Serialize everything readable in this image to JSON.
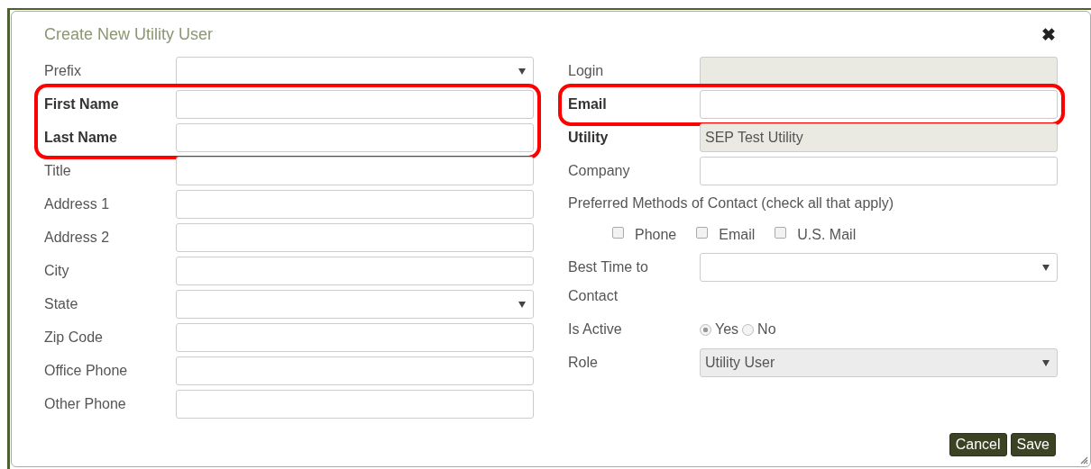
{
  "dialog": {
    "title": "Create New Utility User",
    "close": "✖"
  },
  "left": [
    {
      "kind": "select",
      "label": "Prefix",
      "required": false,
      "highlighted": false
    },
    {
      "kind": "text",
      "label": "First Name",
      "required": true,
      "highlighted": true
    },
    {
      "kind": "text",
      "label": "Last Name",
      "required": true,
      "highlighted": true
    },
    {
      "kind": "text",
      "label": "Title",
      "required": false,
      "highlighted": false
    },
    {
      "kind": "text",
      "label": "Address 1",
      "required": false,
      "highlighted": false
    },
    {
      "kind": "text",
      "label": "Address 2",
      "required": false,
      "highlighted": false
    },
    {
      "kind": "text",
      "label": "City",
      "required": false,
      "highlighted": false
    },
    {
      "kind": "select",
      "label": "State",
      "required": false,
      "highlighted": false
    },
    {
      "kind": "text",
      "label": "Zip Code",
      "required": false,
      "highlighted": false
    },
    {
      "kind": "text",
      "label": "Office Phone",
      "required": false,
      "highlighted": false
    },
    {
      "kind": "text",
      "label": "Other Phone",
      "required": false,
      "highlighted": false
    }
  ],
  "right": [
    {
      "kind": "text",
      "label": "Login",
      "required": false,
      "highlighted": false,
      "disabled": true
    },
    {
      "kind": "text",
      "label": "Email",
      "required": true,
      "highlighted": true,
      "disabled": false
    },
    {
      "kind": "text",
      "label": "Utility",
      "required": true,
      "highlighted": false,
      "disabled": true,
      "value": "SEP Test Utility"
    },
    {
      "kind": "text",
      "label": "Company",
      "required": false,
      "highlighted": false,
      "disabled": false
    },
    {
      "kind": "note",
      "text": "Preferred Methods of Contact (check all that apply)"
    },
    {
      "kind": "checkboxes",
      "options": [
        {
          "label": "Phone",
          "checked": false
        },
        {
          "label": "Email",
          "checked": false
        },
        {
          "label": "U.S. Mail",
          "checked": false
        }
      ]
    },
    {
      "kind": "select",
      "label": "Best Time to Contact",
      "required": false,
      "highlighted": false,
      "disabled": false
    },
    {
      "kind": "radio",
      "label": "Is Active",
      "options": [
        {
          "label": "Yes",
          "selected": true
        },
        {
          "label": "No",
          "selected": false
        }
      ]
    },
    {
      "kind": "select",
      "label": "Role",
      "required": false,
      "highlighted": false,
      "disabled": true,
      "value": "Utility User"
    }
  ],
  "buttons": [
    {
      "label": "Cancel"
    },
    {
      "label": "Save"
    }
  ]
}
